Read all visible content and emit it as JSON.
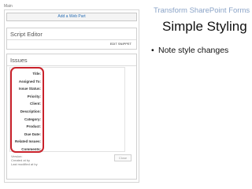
{
  "page": {
    "zone_label": "Main",
    "add_web_part": "Add a Web Part",
    "script_editor": {
      "title": "Script Editor",
      "edit_snippet": "EDIT SNIPPET"
    },
    "issues": {
      "title": "Issues",
      "fields": [
        "Title:",
        "Assigned To:",
        "Issue Status:",
        "Priority:",
        "Client:",
        "Description:",
        "Category:",
        "Product:",
        "Due Date:",
        "Related Issues:",
        "Comments:"
      ],
      "meta": [
        "Version:",
        "Created at by",
        "Last modified at by"
      ],
      "close_label": "Close"
    }
  },
  "slide": {
    "subtitle": "Transform SharePoint Forms",
    "title": "Simple Styling",
    "bullets": [
      "Note style changes"
    ]
  },
  "colors": {
    "highlight": "#c9222b",
    "subtitle": "#8aa3c7",
    "link": "#2a6fb5"
  }
}
